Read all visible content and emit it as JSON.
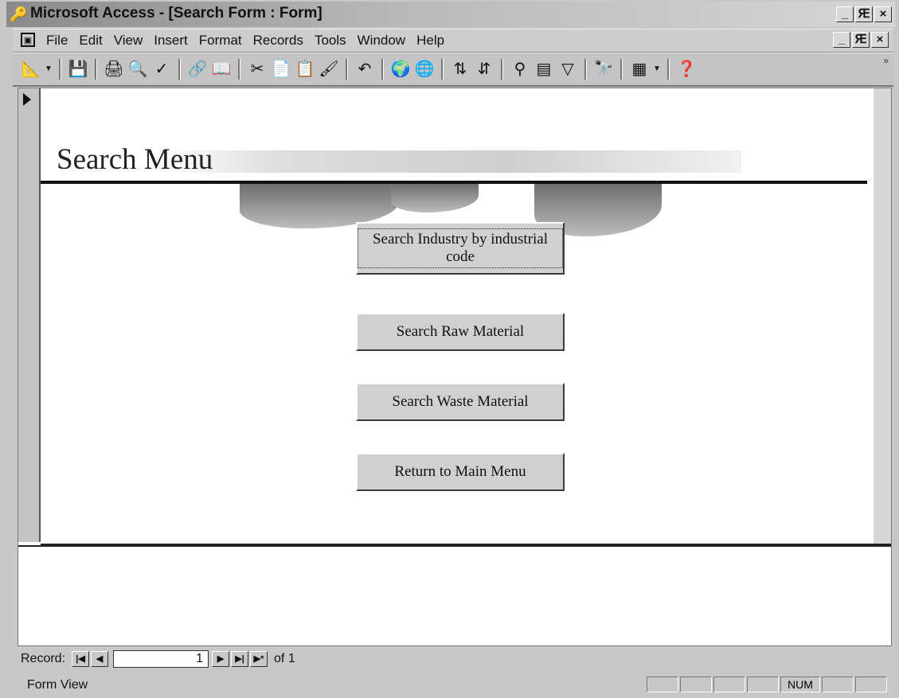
{
  "window": {
    "title": "Microsoft Access - [Search Form : Form]",
    "app_icon": "key-icon",
    "controls": [
      "_",
      "Ԙ",
      "×"
    ]
  },
  "menubar": {
    "items": [
      "File",
      "Edit",
      "View",
      "Insert",
      "Format",
      "Records",
      "Tools",
      "Window",
      "Help"
    ],
    "doc_controls": [
      "_",
      "Ԙ",
      "×"
    ]
  },
  "toolbar": {
    "icons": [
      "design-view-icon",
      "save-icon",
      "print-icon",
      "print-preview-icon",
      "spelling-icon",
      "insert-hyperlink-icon",
      "web-toolbar-icon",
      "cut-icon",
      "copy-icon",
      "paste-icon",
      "format-painter-icon",
      "undo-icon",
      "office-links-icon",
      "web-icon",
      "sort-ascending-icon",
      "sort-descending-icon",
      "filter-by-selection-icon",
      "filter-by-form-icon",
      "apply-filter-icon",
      "find-icon",
      "new-object-icon",
      "help-icon"
    ]
  },
  "form": {
    "title": "Search Menu",
    "buttons": {
      "industry": "Search Industry by industrial code",
      "raw": "Search Raw Material",
      "waste": "Search Waste Material",
      "return": "Return to Main Menu"
    }
  },
  "record_nav": {
    "label": "Record:",
    "current": "1",
    "of_text": "of 1"
  },
  "statusbar": {
    "mode": "Form View",
    "num": "NUM"
  },
  "colors": {
    "title_bar_start": "#8a8a8a",
    "form_background": "#ffffff",
    "button_face": "#d0d0d0"
  }
}
